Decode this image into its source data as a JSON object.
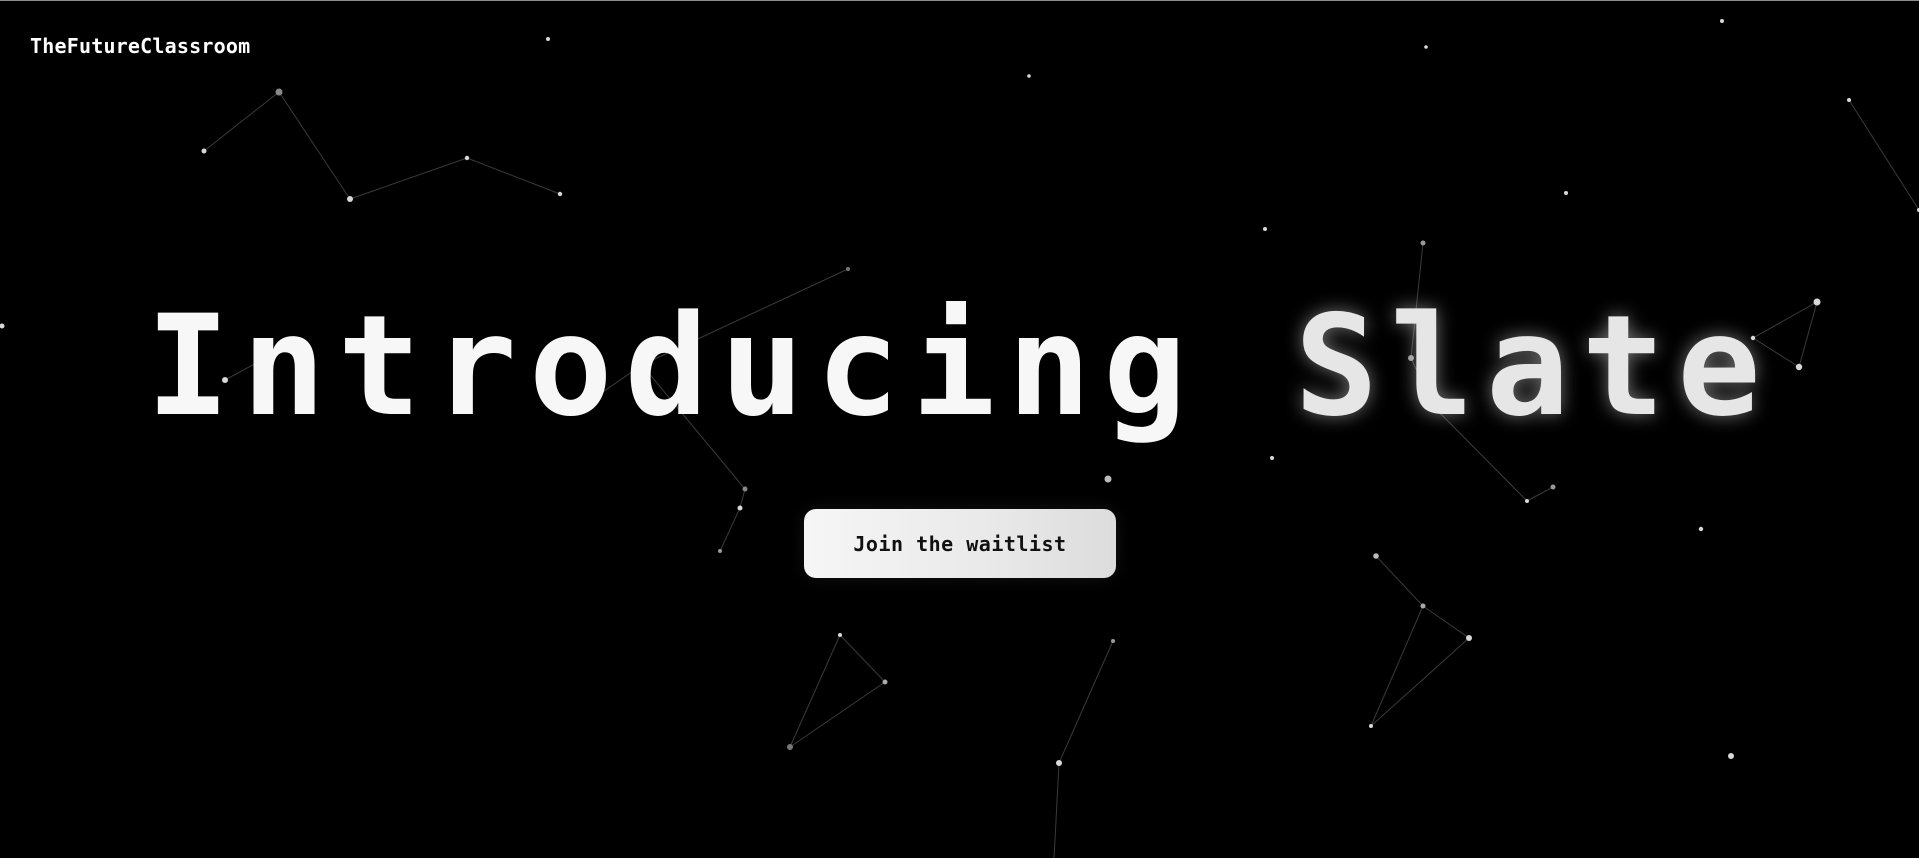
{
  "brand": {
    "name": "TheFutureClassroom"
  },
  "hero": {
    "word1": "Introducing",
    "word2": "Slate"
  },
  "cta": {
    "label": "Join the waitlist"
  },
  "colors": {
    "background": "#000000",
    "text": "#ffffff",
    "button_bg": "#eeeeee",
    "button_text": "#111111"
  },
  "icons": {
    "background": "constellation-network"
  }
}
